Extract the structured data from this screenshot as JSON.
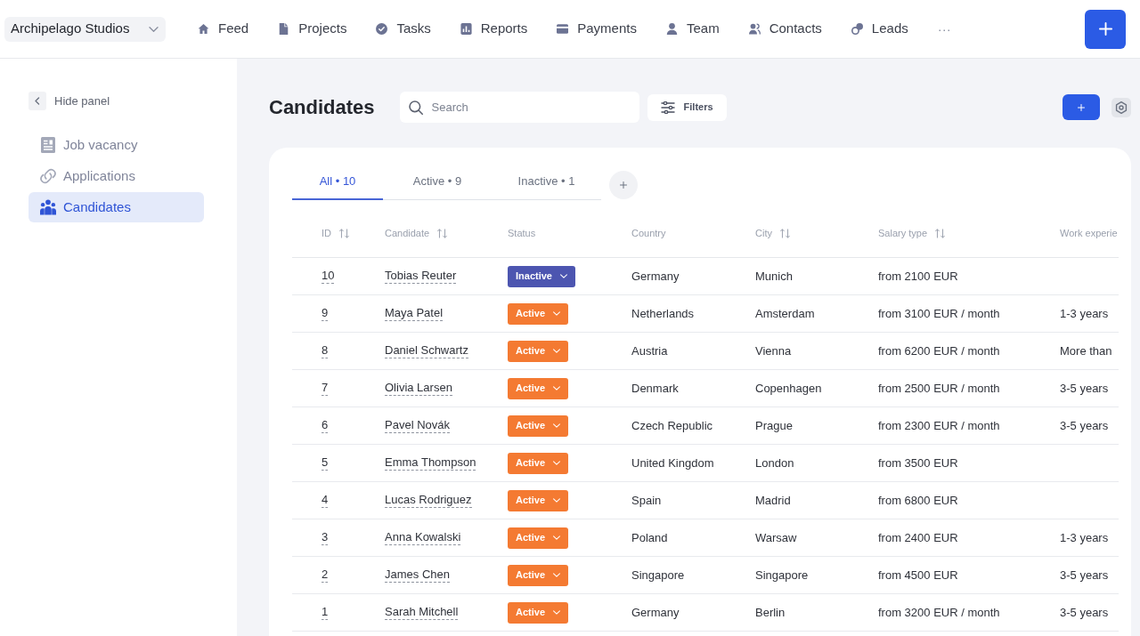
{
  "top_bar": {
    "workspace": "Archipelago Studios",
    "nav": [
      {
        "label": "Feed"
      },
      {
        "label": "Projects"
      },
      {
        "label": "Tasks"
      },
      {
        "label": "Reports"
      },
      {
        "label": "Payments"
      },
      {
        "label": "Team"
      },
      {
        "label": "Contacts"
      },
      {
        "label": "Leads"
      }
    ],
    "more": "···"
  },
  "sidebar": {
    "hide_panel": "Hide panel",
    "items": [
      {
        "label": "Job vacancy",
        "selected": false
      },
      {
        "label": "Applications",
        "selected": false
      },
      {
        "label": "Candidates",
        "selected": true
      }
    ]
  },
  "page": {
    "title": "Candidates",
    "search": {
      "placeholder": "Search"
    },
    "filters": "Filters"
  },
  "tabs": [
    {
      "label": "All • 10",
      "selected": true
    },
    {
      "label": "Active • 9",
      "selected": false
    },
    {
      "label": "Inactive • 1",
      "selected": false
    }
  ],
  "table": {
    "columns": [
      {
        "label": "ID",
        "sortable": true
      },
      {
        "label": "Candidate",
        "sortable": true
      },
      {
        "label": "Status",
        "sortable": false
      },
      {
        "label": "Country",
        "sortable": false
      },
      {
        "label": "City",
        "sortable": true
      },
      {
        "label": "Salary type",
        "sortable": true
      },
      {
        "label": "Work experie",
        "sortable": false
      }
    ],
    "rows": [
      {
        "id": "10",
        "candidate": "Tobias Reuter",
        "status": {
          "label": "Inactive",
          "color": "#4c55b0"
        },
        "country": "Germany",
        "city": "Munich",
        "salary_type": "from 2100 EUR"
      },
      {
        "id": "9",
        "candidate": "Maya Patel",
        "status": {
          "label": "Active",
          "color": "#f47a32"
        },
        "country": "Netherlands",
        "city": "Amsterdam",
        "salary_type": "from 3100 EUR / month",
        "work_experience": "1-3 years"
      },
      {
        "id": "8",
        "candidate": "Daniel Schwartz",
        "status": {
          "label": "Active",
          "color": "#f47a32"
        },
        "country": "Austria",
        "city": "Vienna",
        "salary_type": "from 6200 EUR / month",
        "work_experience": "More than"
      },
      {
        "id": "7",
        "candidate": "Olivia Larsen",
        "status": {
          "label": "Active",
          "color": "#f47a32"
        },
        "country": "Denmark",
        "city": "Copenhagen",
        "salary_type": "from 2500 EUR / month",
        "work_experience": "3-5 years"
      },
      {
        "id": "6",
        "candidate": "Pavel Novák",
        "status": {
          "label": "Active",
          "color": "#f47a32"
        },
        "country": "Czech Republic",
        "city": "Prague",
        "salary_type": "from 2300 EUR / month",
        "work_experience": "3-5 years"
      },
      {
        "id": "5",
        "candidate": "Emma Thompson",
        "status": {
          "label": "Active",
          "color": "#f47a32"
        },
        "country": "United Kingdom",
        "city": "London",
        "salary_type": "from 3500 EUR"
      },
      {
        "id": "4",
        "candidate": "Lucas Rodriguez",
        "status": {
          "label": "Active",
          "color": "#f47a32"
        },
        "country": "Spain",
        "city": "Madrid",
        "salary_type": "from 6800 EUR"
      },
      {
        "id": "3",
        "candidate": "Anna Kowalski",
        "status": {
          "label": "Active",
          "color": "#f47a32"
        },
        "country": "Poland",
        "city": "Warsaw",
        "salary_type": "from 2400 EUR",
        "work_experience": "1-3 years"
      },
      {
        "id": "2",
        "candidate": "James Chen",
        "status": {
          "label": "Active",
          "color": "#f47a32"
        },
        "country": "Singapore",
        "city": "Singapore",
        "salary_type": "from 4500 EUR",
        "work_experience": "3-5 years"
      },
      {
        "id": "1",
        "candidate": "Sarah Mitchell",
        "status": {
          "label": "Active",
          "color": "#f47a32"
        },
        "country": "Germany",
        "city": "Berlin",
        "salary_type": "from 3200 EUR / month",
        "work_experience": "3-5 years"
      }
    ]
  }
}
